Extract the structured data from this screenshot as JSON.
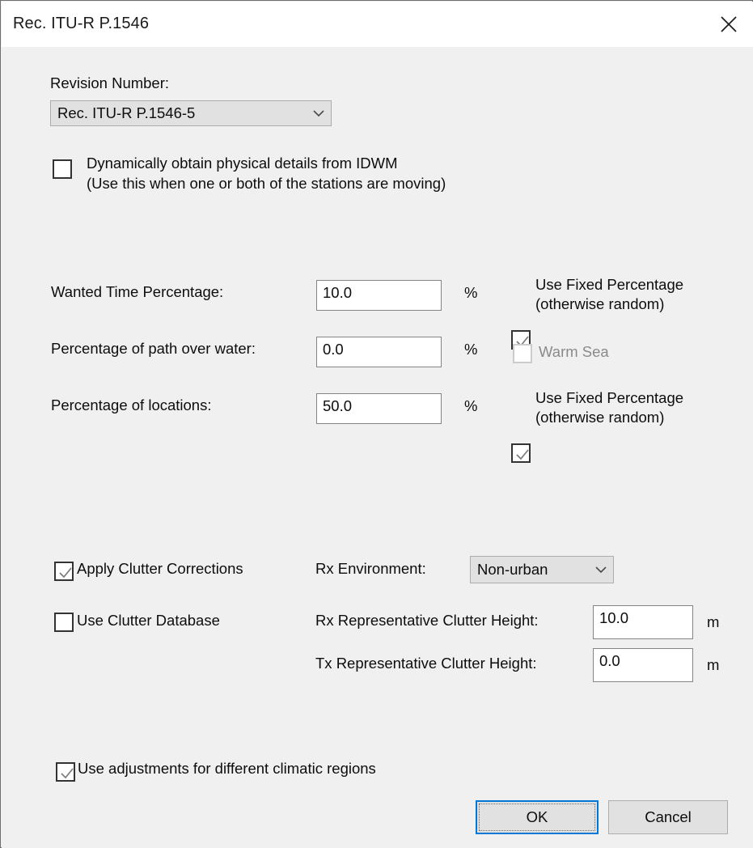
{
  "window": {
    "title": "Rec. ITU-R P.1546",
    "close_icon": "close-icon",
    "accent_color": "#0078d7",
    "surface_color": "#f0f0f0",
    "titlebar_color": "#ffffff"
  },
  "form": {
    "revision_label": "Revision Number:",
    "revision_value": "Rec. ITU-R P.1546-5",
    "dynamic_idwm": {
      "checked": false,
      "line1": "Dynamically obtain physical details from IDWM",
      "line2": "(Use this when one or both of the stations are moving)"
    },
    "rows": [
      {
        "label": "Wanted Time Percentage:",
        "value": "10.0",
        "unit": "%",
        "check_line1": "Use Fixed Percentage",
        "check_line2": "(otherwise random)",
        "checked": true,
        "enabled": true
      },
      {
        "label": "Percentage of path over water:",
        "value": "0.0",
        "unit": "%",
        "check_line1": "Warm Sea",
        "check_line2": "",
        "checked": false,
        "enabled": false
      },
      {
        "label": "Percentage of locations:",
        "value": "50.0",
        "unit": "%",
        "check_line1": "Use Fixed Percentage",
        "check_line2": "(otherwise random)",
        "checked": true,
        "enabled": true
      }
    ],
    "clutter": {
      "apply_label": "Apply Clutter Corrections",
      "apply_checked": true,
      "database_label": "Use Clutter Database",
      "database_checked": false,
      "rx_env_label": "Rx Environment:",
      "rx_env_value": "Non-urban",
      "rx_height_label": "Rx Representative Clutter Height:",
      "rx_height_value": "10.0",
      "rx_height_unit": "m",
      "tx_height_label": "Tx Representative Clutter Height:",
      "tx_height_value": "0.0",
      "tx_height_unit": "m"
    },
    "climatic": {
      "label": "Use adjustments for different climatic regions",
      "checked": true
    }
  },
  "buttons": {
    "ok": "OK",
    "cancel": "Cancel"
  }
}
